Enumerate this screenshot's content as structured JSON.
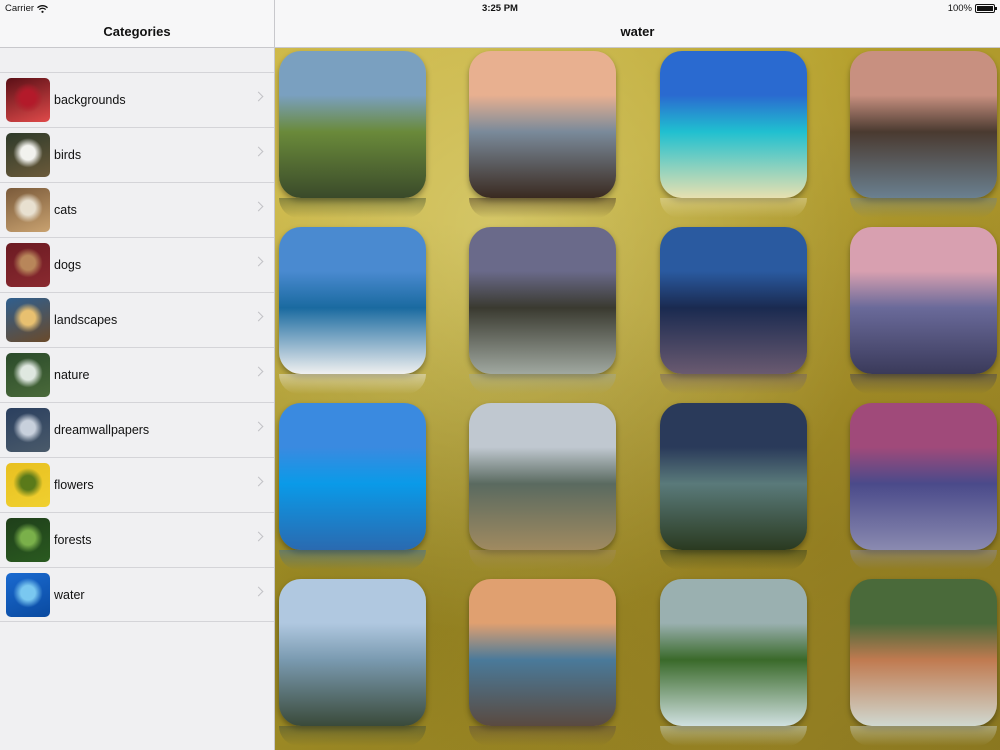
{
  "status_bar": {
    "carrier": "Carrier",
    "time": "3:25 PM",
    "battery": "100%"
  },
  "sidebar": {
    "title": "Categories",
    "items": [
      {
        "label": "backgrounds",
        "thumb": [
          "#5a0f16",
          "#b31a2a",
          "#e04a4a"
        ]
      },
      {
        "label": "birds",
        "thumb": [
          "#2d3a2a",
          "#f2f2ee",
          "#6b5a3a"
        ]
      },
      {
        "label": "cats",
        "thumb": [
          "#7a5a3a",
          "#e8e0d0",
          "#c9a270"
        ]
      },
      {
        "label": "dogs",
        "thumb": [
          "#6b1a22",
          "#b8865a",
          "#8a2a30"
        ]
      },
      {
        "label": "landscapes",
        "thumb": [
          "#2f5f8f",
          "#e8c070",
          "#6a4a2a"
        ]
      },
      {
        "label": "nature",
        "thumb": [
          "#2a4a2a",
          "#dfe8e0",
          "#4a6a3a"
        ]
      },
      {
        "label": "dreamwallpapers",
        "thumb": [
          "#2a3f5f",
          "#c8d0dc",
          "#4a5a6a"
        ]
      },
      {
        "label": "flowers",
        "thumb": [
          "#e8c020",
          "#5a7a1a",
          "#f0d030"
        ]
      },
      {
        "label": "forests",
        "thumb": [
          "#1f3f1a",
          "#7ab04a",
          "#2a5a20"
        ]
      },
      {
        "label": "water",
        "thumb": [
          "#1a6ad0",
          "#7ac8f0",
          "#0a4aa0"
        ]
      }
    ]
  },
  "main": {
    "title": "water",
    "tiles": [
      {
        "name": "waterfall-cliff",
        "colors": [
          "#7aa0c0",
          "#6a8a3a",
          "#3a4a2a"
        ]
      },
      {
        "name": "driftwood-beach",
        "colors": [
          "#e8b090",
          "#7a8a9a",
          "#3a2a20"
        ]
      },
      {
        "name": "tropical-lagoon",
        "colors": [
          "#2a6ad0",
          "#20c0d0",
          "#e8e0b0"
        ]
      },
      {
        "name": "rocky-falls",
        "colors": [
          "#c89080",
          "#4a3a30",
          "#6a8090"
        ]
      },
      {
        "name": "mountain-lake",
        "colors": [
          "#4a8ad0",
          "#1a6aa0",
          "#f0f0f0"
        ]
      },
      {
        "name": "misty-rocks",
        "colors": [
          "#6a6a8a",
          "#3a3a30",
          "#a0a8a0"
        ]
      },
      {
        "name": "bridge-dusk",
        "colors": [
          "#2a5aa0",
          "#1a2a50",
          "#6a5a70"
        ]
      },
      {
        "name": "purple-shore",
        "colors": [
          "#d8a0b0",
          "#6a6a9a",
          "#3a3a5a"
        ]
      },
      {
        "name": "island-ocean",
        "colors": [
          "#3a8ae0",
          "#0a9ae8",
          "#2a6ab0"
        ]
      },
      {
        "name": "stone-arch",
        "colors": [
          "#c0c8d0",
          "#5a6a60",
          "#a08a60"
        ]
      },
      {
        "name": "palm-night",
        "colors": [
          "#2a3a5a",
          "#5a7a7a",
          "#2a3a20"
        ]
      },
      {
        "name": "sunset-pier",
        "colors": [
          "#a04a7a",
          "#4a4a8a",
          "#8a8ab0"
        ]
      },
      {
        "name": "cloudy-coast",
        "colors": [
          "#b0c8e0",
          "#7a9ab0",
          "#3a4a3a"
        ]
      },
      {
        "name": "rocky-bay",
        "colors": [
          "#e0a070",
          "#4a7a9a",
          "#5a4a40"
        ]
      },
      {
        "name": "multnomah-falls",
        "colors": [
          "#9ab0b0",
          "#3a6a2a",
          "#d0e0e0"
        ]
      },
      {
        "name": "river-stone",
        "colors": [
          "#4a6a3a",
          "#c07a50",
          "#d0d8d0"
        ]
      }
    ]
  }
}
